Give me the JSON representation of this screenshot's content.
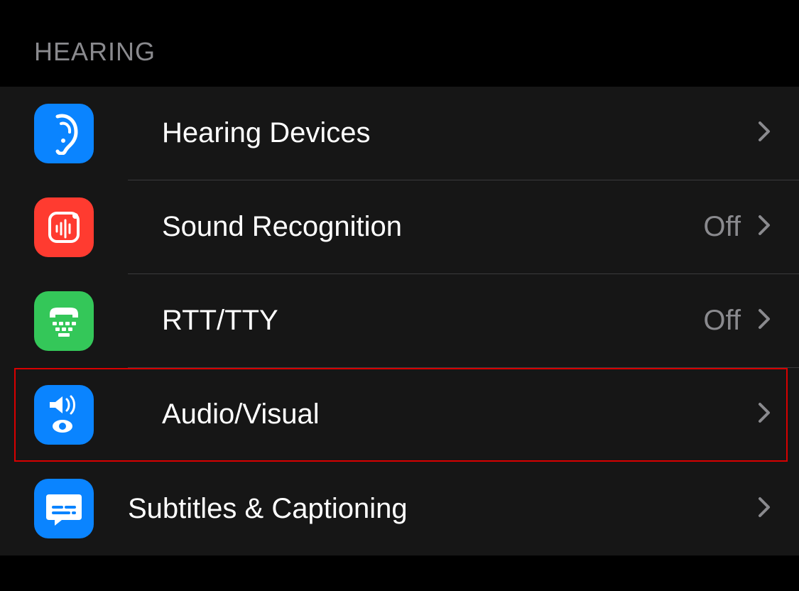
{
  "section": {
    "header": "HEARING",
    "items": [
      {
        "id": "hearing-devices",
        "label": "Hearing Devices",
        "value": null,
        "icon": "ear-icon",
        "color": "#0a84ff",
        "highlighted": false
      },
      {
        "id": "sound-recognition",
        "label": "Sound Recognition",
        "value": "Off",
        "icon": "sound-recognition-icon",
        "color": "#ff3b30",
        "highlighted": false
      },
      {
        "id": "rtt-tty",
        "label": "RTT/TTY",
        "value": "Off",
        "icon": "tty-icon",
        "color": "#34c759",
        "highlighted": false
      },
      {
        "id": "audio-visual",
        "label": "Audio/Visual",
        "value": null,
        "icon": "audio-visual-icon",
        "color": "#0a84ff",
        "highlighted": true
      },
      {
        "id": "subtitles-captioning",
        "label": "Subtitles & Captioning",
        "value": null,
        "icon": "captions-icon",
        "color": "#0a84ff",
        "highlighted": false
      }
    ]
  }
}
